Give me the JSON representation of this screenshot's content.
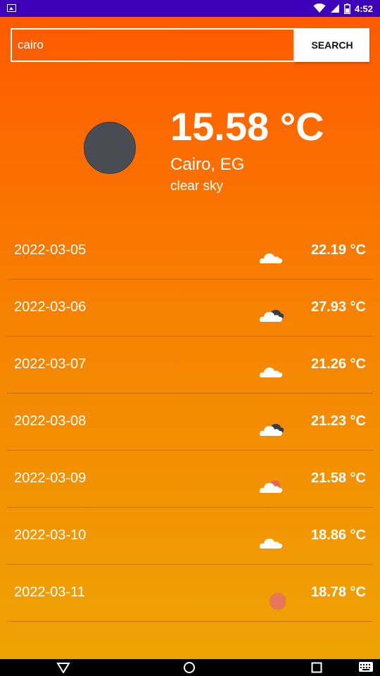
{
  "status_bar": {
    "time": "4:52",
    "icons": [
      "image-notification-icon",
      "wifi-icon",
      "cellular-signal-icon",
      "battery-icon"
    ]
  },
  "search": {
    "value": "cairo",
    "button_label": "SEARCH"
  },
  "current": {
    "temperature": "15.58 °C",
    "location": "Cairo, EG",
    "description": "clear sky",
    "icon": "dark-circle-icon"
  },
  "forecast": [
    {
      "date": "2022-03-05",
      "temp": "22.19 °C",
      "icon": "cloud-icon"
    },
    {
      "date": "2022-03-06",
      "temp": "27.93 °C",
      "icon": "broken-clouds-icon"
    },
    {
      "date": "2022-03-07",
      "temp": "21.26 °C",
      "icon": "cloud-icon"
    },
    {
      "date": "2022-03-08",
      "temp": "21.23 °C",
      "icon": "broken-clouds-icon"
    },
    {
      "date": "2022-03-09",
      "temp": "21.58 °C",
      "icon": "sun-behind-cloud-icon"
    },
    {
      "date": "2022-03-10",
      "temp": "18.86 °C",
      "icon": "cloud-icon"
    },
    {
      "date": "2022-03-11",
      "temp": "18.78 °C",
      "icon": "sun-icon"
    }
  ],
  "colors": {
    "status_bar": "#3d00b8",
    "gradient_top": "#ff5a00",
    "gradient_bottom": "#eea304",
    "text": "#ffffff"
  },
  "nav_bar": {
    "icons": [
      "back-icon",
      "home-icon",
      "recents-icon",
      "keyboard-icon"
    ]
  }
}
